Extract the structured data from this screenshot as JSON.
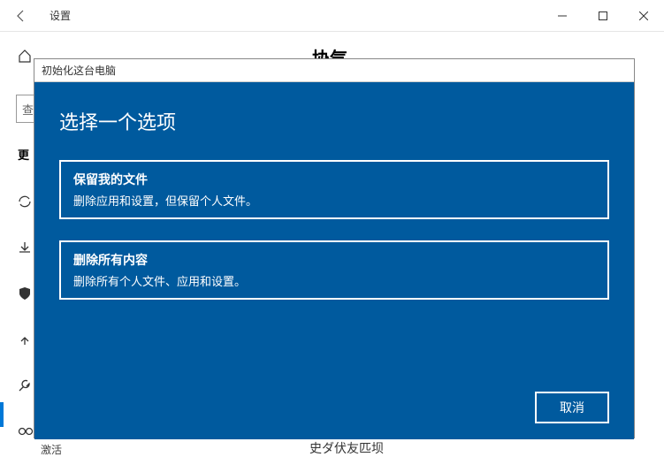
{
  "titlebar": {
    "title": "设置"
  },
  "sidebar": {
    "search_placeholder": "查",
    "section_label": "更",
    "activate": "激活"
  },
  "right": {
    "title_peek": "协气",
    "bottom_text": "史ダ伏友匹坝"
  },
  "modal": {
    "header": "初始化这台电脑",
    "title": "选择一个选项",
    "option1": {
      "title": "保留我的文件",
      "desc": "删除应用和设置，但保留个人文件。"
    },
    "option2": {
      "title": "删除所有内容",
      "desc": "删除所有个人文件、应用和设置。"
    },
    "cancel": "取消"
  }
}
